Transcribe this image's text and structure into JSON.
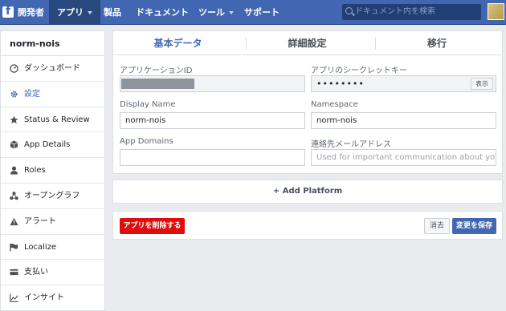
{
  "topbar": {
    "brand": "開発者",
    "nav": [
      {
        "label": "アプリ",
        "has_caret": true,
        "active": true
      },
      {
        "label": "製品"
      },
      {
        "label": "ドキュメント"
      },
      {
        "label": "ツール",
        "has_caret": true
      },
      {
        "label": "サポート"
      }
    ],
    "search_placeholder": "ドキュメント内を検索"
  },
  "sidebar": {
    "app_name": "norm-nois",
    "items": [
      {
        "label": "ダッシュボード",
        "icon": "dashboard-icon"
      },
      {
        "label": "設定",
        "icon": "gear-icon",
        "active": true
      },
      {
        "label": "Status & Review",
        "icon": "star-icon"
      },
      {
        "label": "App Details",
        "icon": "cube-icon"
      },
      {
        "label": "Roles",
        "icon": "person-icon"
      },
      {
        "label": "オープングラフ",
        "icon": "nodes-icon"
      },
      {
        "label": "アラート",
        "icon": "warning-icon"
      },
      {
        "label": "Localize",
        "icon": "flag-icon"
      },
      {
        "label": "支払い",
        "icon": "card-icon"
      },
      {
        "label": "インサイト",
        "icon": "chart-icon"
      }
    ]
  },
  "main": {
    "tabs": [
      {
        "label": "基本データ",
        "active": true
      },
      {
        "label": "詳細設定"
      },
      {
        "label": "移行"
      }
    ],
    "fields": {
      "app_id_label": "アプリケーションID",
      "app_secret_label": "アプリのシークレットキー",
      "app_secret_value": "••••••••",
      "show_button": "表示",
      "display_name_label": "Display Name",
      "display_name_value": "norm-nois",
      "namespace_label": "Namespace",
      "namespace_value": "norm-nois",
      "app_domains_label": "App Domains",
      "app_domains_value": "",
      "contact_email_label": "連絡先メールアドレス",
      "contact_email_placeholder": "Used for important communication about your app"
    },
    "add_platform": "+ Add Platform",
    "actions": {
      "delete": "アプリを削除する",
      "discard": "消去",
      "save": "変更を保存"
    }
  },
  "colors": {
    "brand": "#4267b2",
    "delete": "#e00d0d"
  }
}
